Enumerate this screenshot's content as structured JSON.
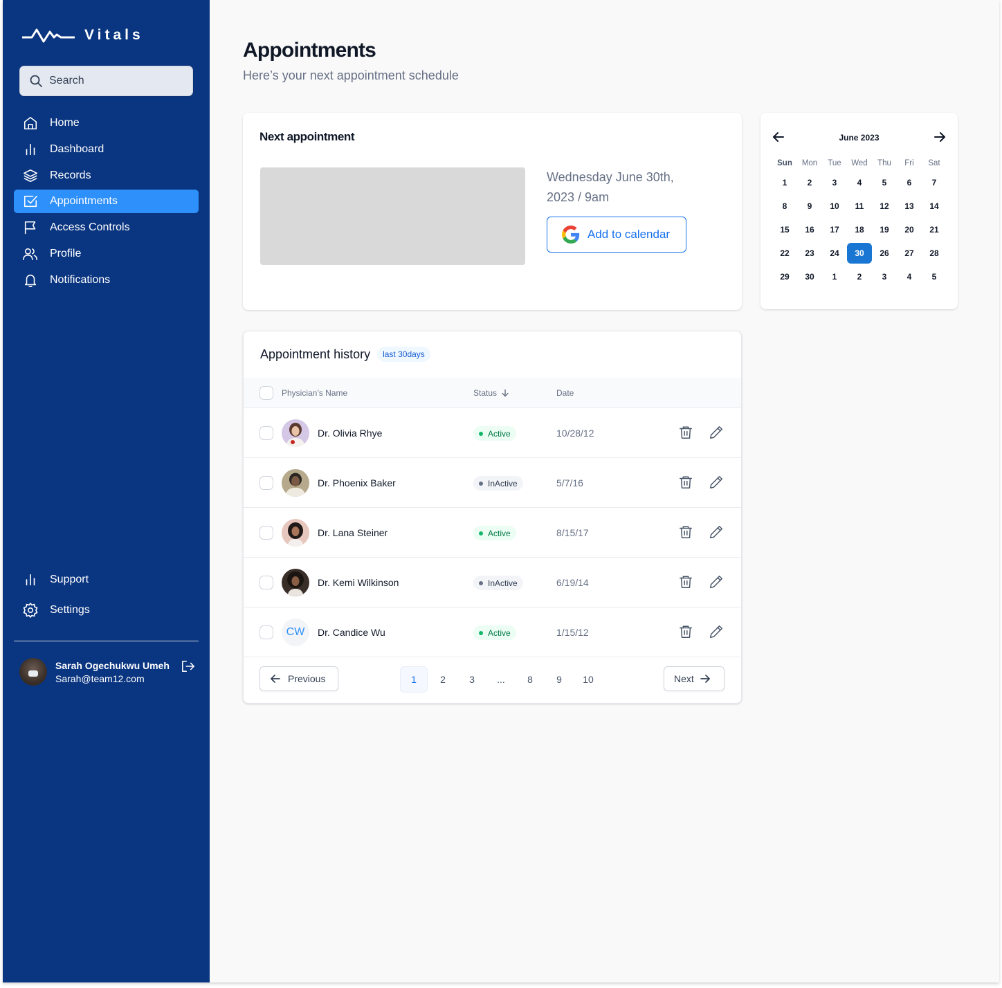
{
  "app": {
    "name": "Vitals"
  },
  "search": {
    "placeholder": "Search"
  },
  "sidebar": {
    "items": [
      {
        "label": "Home",
        "icon": "home-icon"
      },
      {
        "label": "Dashboard",
        "icon": "bar-chart-icon"
      },
      {
        "label": "Records",
        "icon": "layers-icon"
      },
      {
        "label": "Appointments",
        "icon": "check-square-icon",
        "active": true
      },
      {
        "label": "Access Controls",
        "icon": "flag-icon"
      },
      {
        "label": "Profile",
        "icon": "users-icon"
      },
      {
        "label": "Notifications",
        "icon": "bell-icon"
      }
    ],
    "bottom_items": [
      {
        "label": "Support",
        "icon": "bar-chart-icon"
      },
      {
        "label": "Settings",
        "icon": "gear-icon"
      }
    ]
  },
  "user": {
    "name": "Sarah Ogechukwu Umeh",
    "email": "Sarah@team12.com"
  },
  "page": {
    "title": "Appointments",
    "subtitle": "Here’s your next appointment schedule"
  },
  "next_appointment": {
    "title": "Next appointment",
    "date_line": "Wednesday June 30th, 2023 / 9am",
    "add_to_calendar": "Add to calendar"
  },
  "calendar": {
    "month": "June 2023",
    "weekdays": [
      "Sun",
      "Mon",
      "Tue",
      "Wed",
      "Thu",
      "Fri",
      "Sat"
    ],
    "weeks": [
      [
        "1",
        "2",
        "3",
        "4",
        "5",
        "6",
        "7"
      ],
      [
        "8",
        "9",
        "10",
        "11",
        "12",
        "13",
        "14"
      ],
      [
        "15",
        "16",
        "17",
        "18",
        "19",
        "20",
        "21"
      ],
      [
        "22",
        "23",
        "24",
        "30",
        "26",
        "27",
        "28"
      ],
      [
        "29",
        "30",
        "1",
        "2",
        "3",
        "4",
        "5"
      ]
    ],
    "selected": "30"
  },
  "history": {
    "title": "Appointment history",
    "badge": "last 30days",
    "columns": {
      "name": "Physician’s Name",
      "status": "Status",
      "date": "Date"
    },
    "rows": [
      {
        "name": "Dr. Olivia Rhye",
        "status": "Active",
        "date": "10/28/12"
      },
      {
        "name": "Dr. Phoenix Baker",
        "status": "InActive",
        "date": "5/7/16"
      },
      {
        "name": "Dr. Lana Steiner",
        "status": "Active",
        "date": "8/15/17"
      },
      {
        "name": "Dr. Kemi Wilkinson",
        "status": "InActive",
        "date": "6/19/14"
      },
      {
        "name": "Dr. Candice Wu",
        "status": "Active",
        "date": "1/15/12",
        "initials": "CW"
      }
    ],
    "pagination": {
      "previous": "Previous",
      "next": "Next",
      "pages": [
        "1",
        "2",
        "3",
        "...",
        "8",
        "9",
        "10"
      ],
      "current": "1"
    }
  },
  "colors": {
    "sidebar_bg": "#0a3580",
    "active_nav": "#2e90fa",
    "primary": "#1570ef",
    "calendar_selected": "#1976d2",
    "status_active": "#027a48",
    "status_inactive": "#344054"
  }
}
